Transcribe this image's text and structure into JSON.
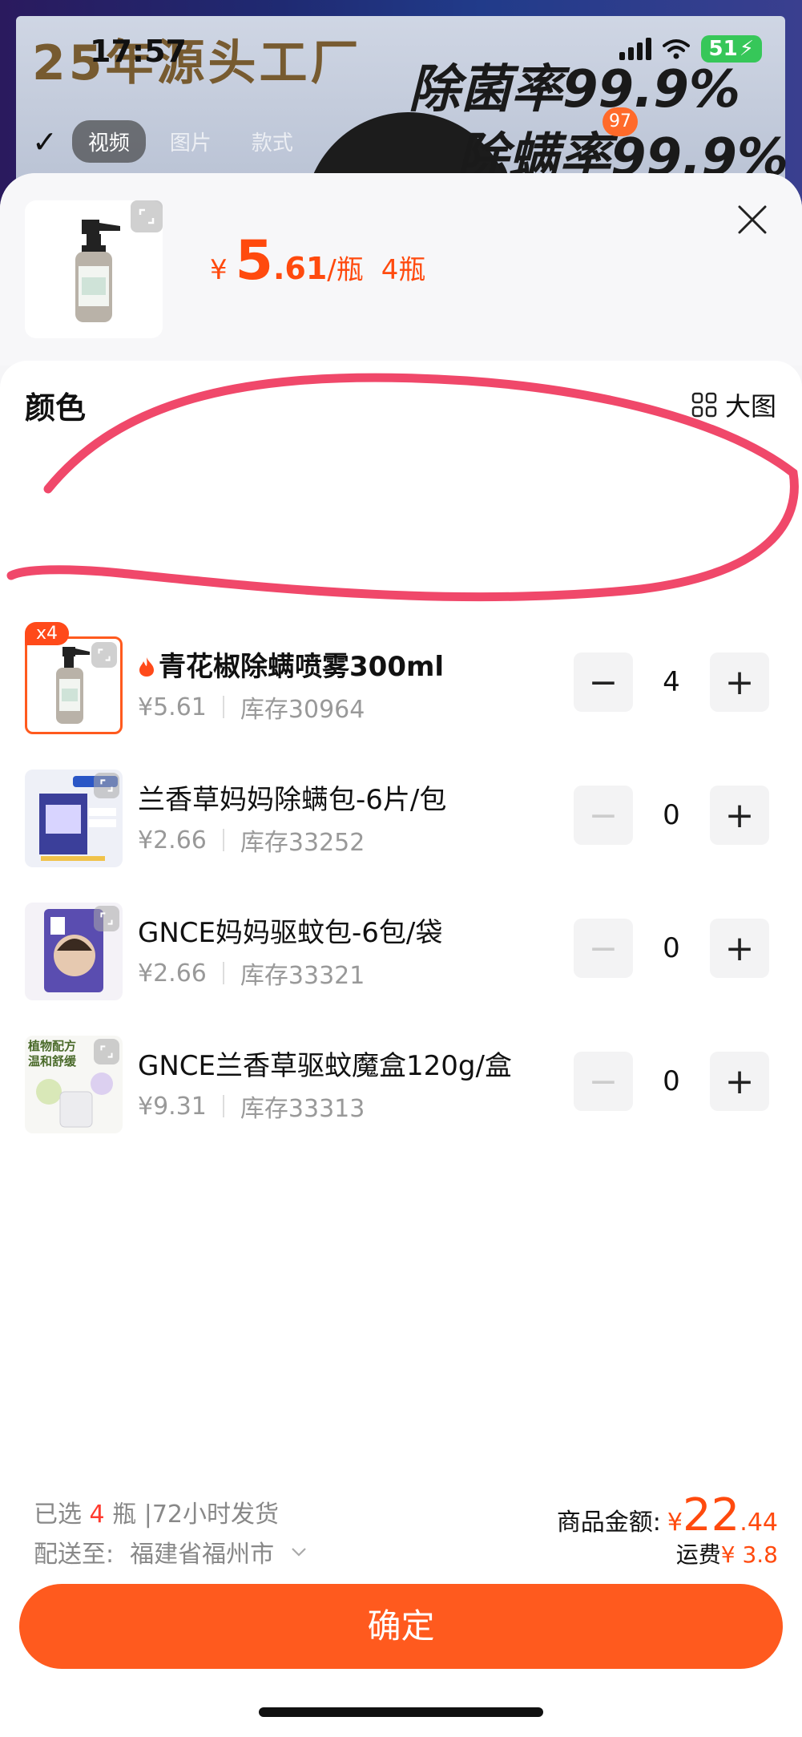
{
  "status_bar": {
    "time": "17:57",
    "battery": "51"
  },
  "background": {
    "headline": "25年源头工厂",
    "slogan1": "除菌率99.9%",
    "slogan2": "除螨率99.9%",
    "tabs": [
      "视频",
      "图片",
      "款式"
    ],
    "badge": "97"
  },
  "sheet": {
    "price": {
      "currency": "¥",
      "integer": "5",
      "decimal": ".61",
      "unit": "/瓶",
      "quantity": "4瓶"
    },
    "section_title": "颜色",
    "big_image_label": "大图",
    "items": [
      {
        "name": "青花椒除螨喷雾300ml",
        "price": "¥5.61",
        "stock": "库存30964",
        "qty": "4",
        "badge": "x4",
        "hot": true,
        "selected": true
      },
      {
        "name": "兰香草妈妈除螨包-6片/包",
        "price": "¥2.66",
        "stock": "库存33252",
        "qty": "0"
      },
      {
        "name": "GNCE妈妈驱蚊包-6包/袋",
        "price": "¥2.66",
        "stock": "库存33321",
        "qty": "0"
      },
      {
        "name": "GNCE兰香草驱蚊魔盒120g/盒",
        "price": "¥9.31",
        "stock": "库存33313",
        "qty": "0"
      }
    ],
    "item_images": {
      "item3_text": "植物配方 温和舒缓"
    }
  },
  "footer": {
    "selected_prefix": "已选",
    "selected_count": "4",
    "selected_suffix": "瓶 |72小时发货",
    "ship_to_label": "配送至:",
    "ship_to_value": "福建省福州市",
    "amount_label": "商品金额:",
    "amount_currency": "¥",
    "amount_int": "22",
    "amount_dec": ".44",
    "shipping_label": "运费",
    "shipping_value": "¥ 3.8",
    "confirm_label": "确定"
  },
  "colors": {
    "accent": "#ff5a1e",
    "price": "#ff4a0e",
    "annotation": "#f0486a"
  }
}
